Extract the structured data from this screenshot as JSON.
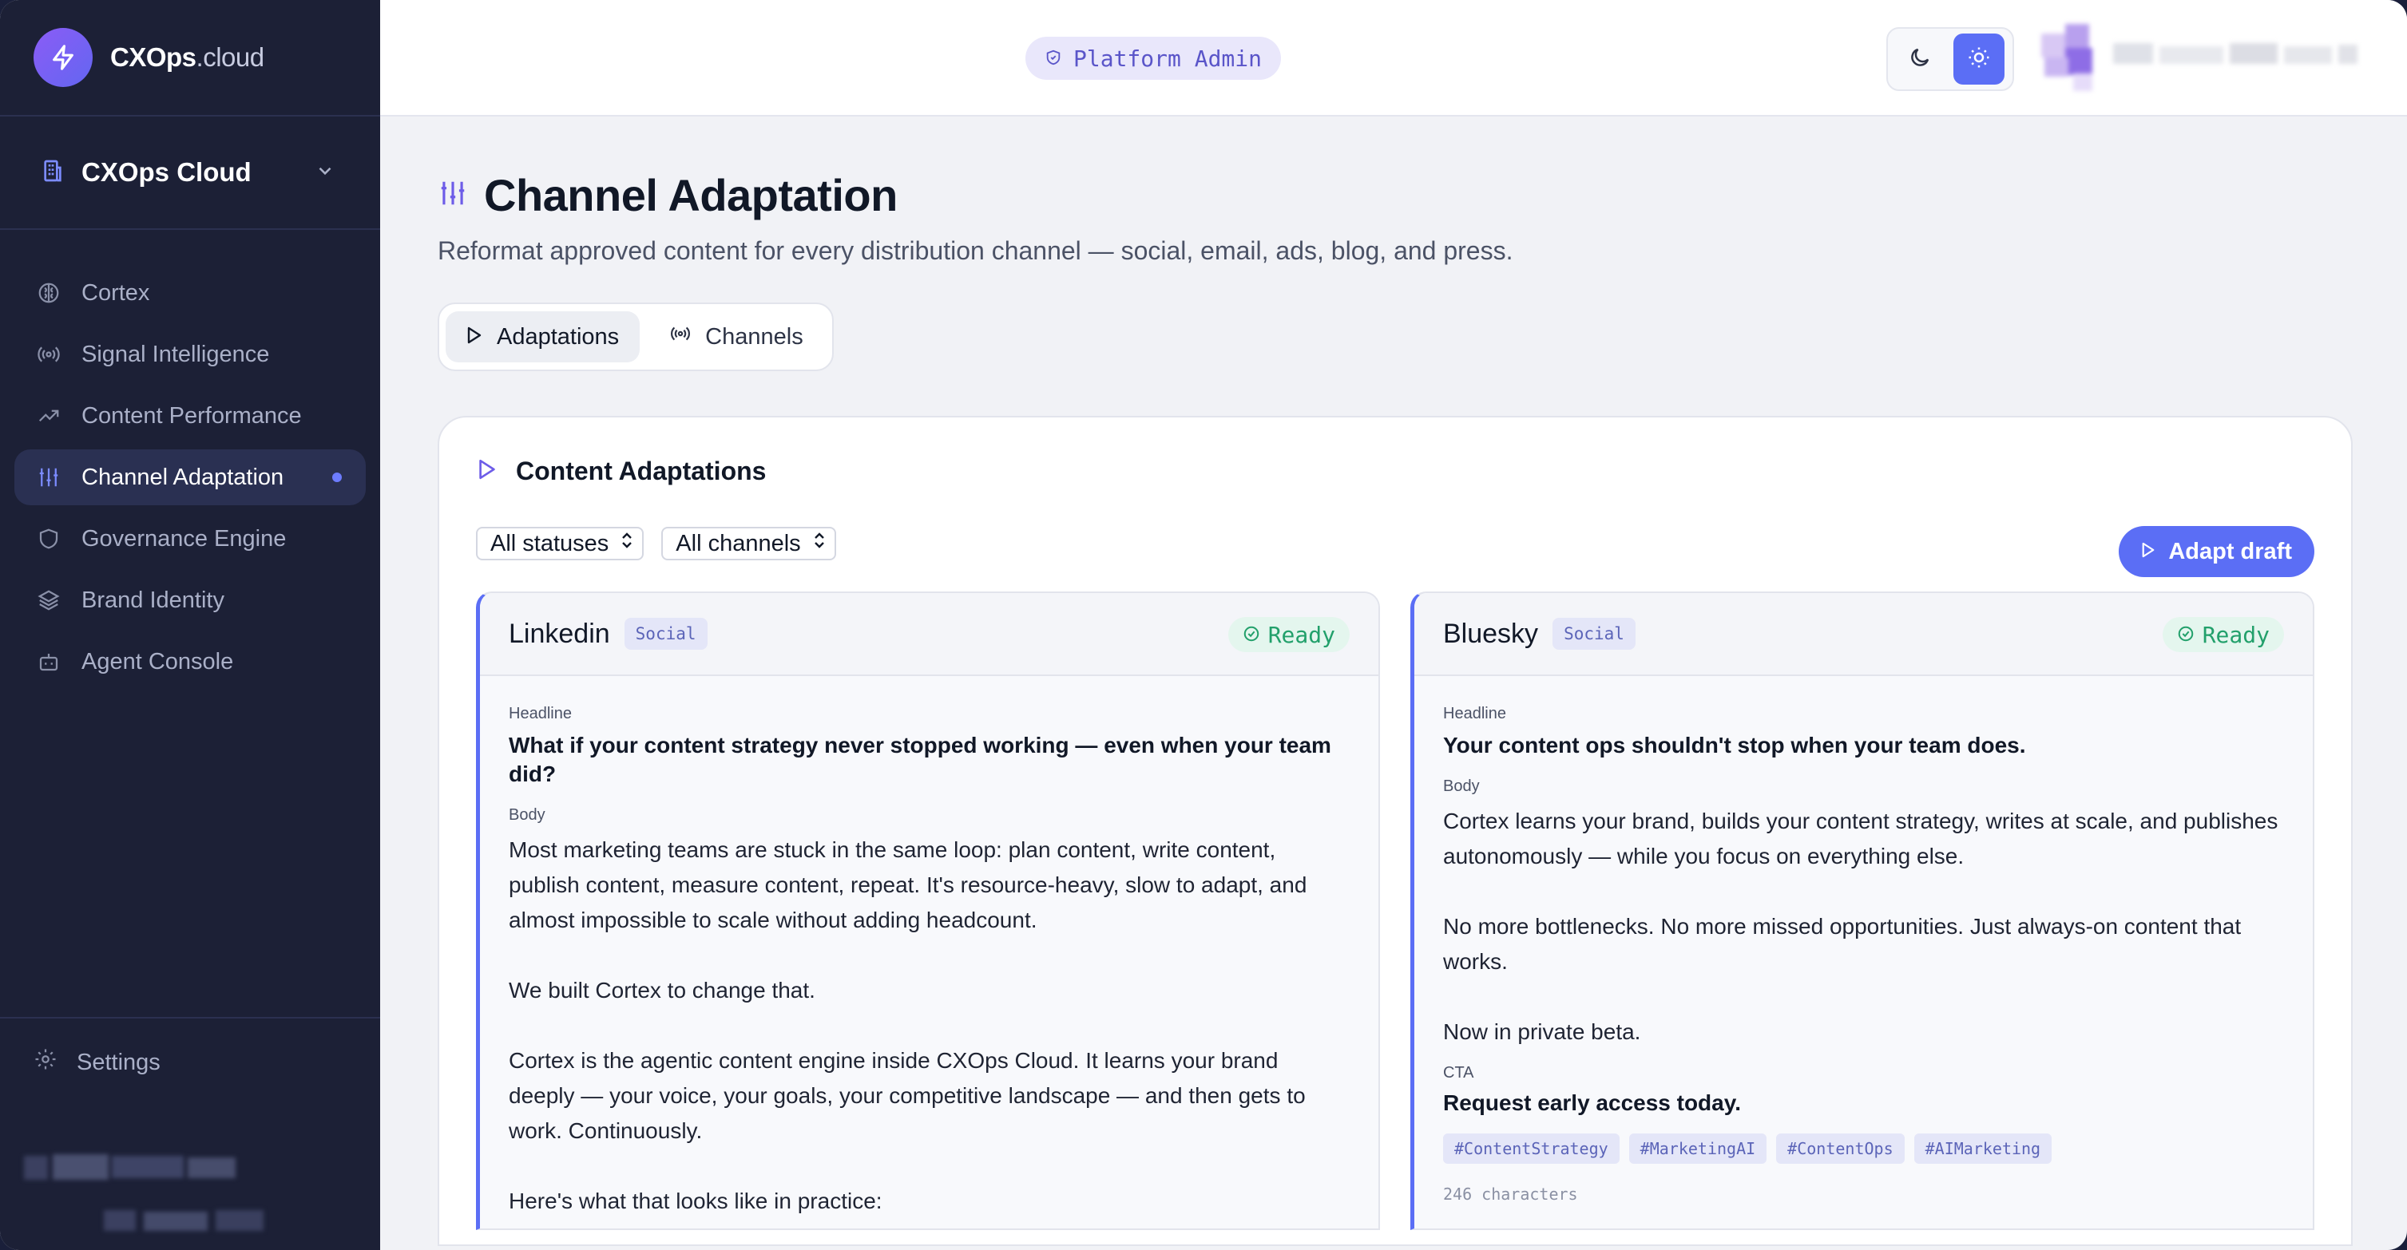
{
  "brand": {
    "name_bold": "CXOps",
    "name_light": ".cloud"
  },
  "workspace": {
    "name": "CXOps Cloud"
  },
  "sidebar": {
    "items": [
      {
        "label": "Cortex",
        "icon": "brain-icon"
      },
      {
        "label": "Signal Intelligence",
        "icon": "radio-icon"
      },
      {
        "label": "Content Performance",
        "icon": "trending-up-icon"
      },
      {
        "label": "Channel Adaptation",
        "icon": "sliders-icon",
        "active": true
      },
      {
        "label": "Governance Engine",
        "icon": "shield-icon"
      },
      {
        "label": "Brand Identity",
        "icon": "layers-icon"
      },
      {
        "label": "Agent Console",
        "icon": "bot-icon"
      }
    ],
    "settings_label": "Settings"
  },
  "topbar": {
    "role_badge": "Platform Admin"
  },
  "page": {
    "title": "Channel Adaptation",
    "subtitle": "Reformat approved content for every distribution channel — social, email, ads, blog, and press."
  },
  "tabs": [
    {
      "label": "Adaptations",
      "active": true
    },
    {
      "label": "Channels",
      "active": false
    }
  ],
  "panel": {
    "title": "Content Adaptations",
    "filter_status": "All statuses",
    "filter_channel": "All channels",
    "adapt_button": "Adapt draft"
  },
  "cards": [
    {
      "channel": "Linkedin",
      "category": "Social",
      "status": "Ready",
      "headline_label": "Headline",
      "headline": "What if your content strategy never stopped working — even when your team did?",
      "body_label": "Body",
      "body": "Most marketing teams are stuck in the same loop: plan content, write content, publish content, measure content, repeat. It's resource-heavy, slow to adapt, and almost impossible to scale without adding headcount.\n\nWe built Cortex to change that.\n\nCortex is the agentic content engine inside CXOps Cloud. It learns your brand deeply — your voice, your goals, your competitive landscape — and then gets to work. Continuously.\n\nHere's what that looks like in practice:"
    },
    {
      "channel": "Bluesky",
      "category": "Social",
      "status": "Ready",
      "headline_label": "Headline",
      "headline": "Your content ops shouldn't stop when your team does.",
      "body_label": "Body",
      "body": "Cortex learns your brand, builds your content strategy, writes at scale, and publishes autonomously — while you focus on everything else.\n\nNo more bottlenecks. No more missed opportunities. Just always-on content that works.\n\nNow in private beta.",
      "cta_label": "CTA",
      "cta": "Request early access today.",
      "hashtags": [
        "#ContentStrategy",
        "#MarketingAI",
        "#ContentOps",
        "#AIMarketing"
      ],
      "char_count": "246 characters"
    }
  ],
  "colors": {
    "accent": "#5b6ef5",
    "sidebar_bg": "#1c2036",
    "ready": "#22a06b"
  }
}
